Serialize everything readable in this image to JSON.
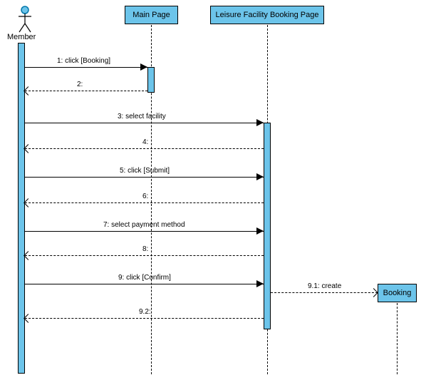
{
  "participants": {
    "actor": {
      "label": "Member"
    },
    "main_page": {
      "label": "Main Page"
    },
    "booking_page": {
      "label": "Leisure Facility Booking Page"
    },
    "booking": {
      "label": "Booking"
    }
  },
  "messages": {
    "m1": "1: click [Booking]",
    "m2": "2:",
    "m3": "3: select facility",
    "m4": "4:",
    "m5": "5: click [Submit]",
    "m6": "6:",
    "m7": "7: select payment method",
    "m8": "8:",
    "m9": "9: click [Confirm]",
    "m91": "9.1: create",
    "m92": "9.2:"
  },
  "chart_data": {
    "type": "table",
    "diagram": "UML Sequence Diagram",
    "participants": [
      "Member",
      "Main Page",
      "Leisure Facility Booking Page",
      "Booking"
    ],
    "interactions": [
      {
        "seq": "1",
        "from": "Member",
        "to": "Main Page",
        "kind": "sync",
        "label": "click [Booking]"
      },
      {
        "seq": "2",
        "from": "Main Page",
        "to": "Member",
        "kind": "return",
        "label": ""
      },
      {
        "seq": "3",
        "from": "Member",
        "to": "Leisure Facility Booking Page",
        "kind": "sync",
        "label": "select facility"
      },
      {
        "seq": "4",
        "from": "Leisure Facility Booking Page",
        "to": "Member",
        "kind": "return",
        "label": ""
      },
      {
        "seq": "5",
        "from": "Member",
        "to": "Leisure Facility Booking Page",
        "kind": "sync",
        "label": "click [Submit]"
      },
      {
        "seq": "6",
        "from": "Leisure Facility Booking Page",
        "to": "Member",
        "kind": "return",
        "label": ""
      },
      {
        "seq": "7",
        "from": "Member",
        "to": "Leisure Facility Booking Page",
        "kind": "sync",
        "label": "select payment method"
      },
      {
        "seq": "8",
        "from": "Leisure Facility Booking Page",
        "to": "Member",
        "kind": "return",
        "label": ""
      },
      {
        "seq": "9",
        "from": "Member",
        "to": "Leisure Facility Booking Page",
        "kind": "sync",
        "label": "click [Confirm]"
      },
      {
        "seq": "9.1",
        "from": "Leisure Facility Booking Page",
        "to": "Booking",
        "kind": "create",
        "label": "create"
      },
      {
        "seq": "9.2",
        "from": "Leisure Facility Booking Page",
        "to": "Member",
        "kind": "return",
        "label": ""
      }
    ]
  }
}
